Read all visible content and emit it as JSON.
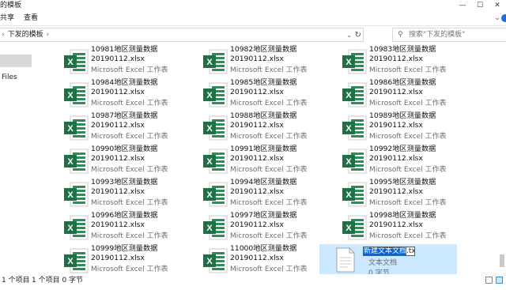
{
  "window": {
    "title": "的模板"
  },
  "window_controls": {
    "minimize": "—",
    "maximize": "☐",
    "close": "✕"
  },
  "ribbon": {
    "tabs": [
      "共享",
      "查看"
    ]
  },
  "address": {
    "path_segment": "下发的模板",
    "separator": "›"
  },
  "search": {
    "placeholder": "搜索\"下发的模板\""
  },
  "nav": {
    "files_label": "Files"
  },
  "files": [
    {
      "name1": "10981地区测量数据",
      "name2": "20190112.xlsx",
      "type": "Microsoft Excel 工作表"
    },
    {
      "name1": "10982地区测量数据",
      "name2": "20190112.xlsx",
      "type": "Microsoft Excel 工作表"
    },
    {
      "name1": "10983地区测量数据",
      "name2": "20190112.xlsx",
      "type": "Microsoft Excel 工作表"
    },
    {
      "name1": "10984地区测量数据",
      "name2": "20190112.xlsx",
      "type": "Microsoft Excel 工作表"
    },
    {
      "name1": "10985地区测量数据",
      "name2": "20190112.xlsx",
      "type": "Microsoft Excel 工作表"
    },
    {
      "name1": "10986地区测量数据",
      "name2": "20190112.xlsx",
      "type": "Microsoft Excel 工作表"
    },
    {
      "name1": "10987地区测量数据",
      "name2": "20190112.xlsx",
      "type": "Microsoft Excel 工作表"
    },
    {
      "name1": "10988地区测量数据",
      "name2": "20190112.xlsx",
      "type": "Microsoft Excel 工作表"
    },
    {
      "name1": "10989地区测量数据",
      "name2": "20190112.xlsx",
      "type": "Microsoft Excel 工作表"
    },
    {
      "name1": "10990地区测量数据",
      "name2": "20190112.xlsx",
      "type": "Microsoft Excel 工作表"
    },
    {
      "name1": "10991地区测量数据",
      "name2": "20190112.xlsx",
      "type": "Microsoft Excel 工作表"
    },
    {
      "name1": "10992地区测量数据",
      "name2": "20190112.xlsx",
      "type": "Microsoft Excel 工作表"
    },
    {
      "name1": "10993地区测量数据",
      "name2": "20190112.xlsx",
      "type": "Microsoft Excel 工作表"
    },
    {
      "name1": "10994地区测量数据",
      "name2": "20190112.xlsx",
      "type": "Microsoft Excel 工作表"
    },
    {
      "name1": "10995地区测量数据",
      "name2": "20190112.xlsx",
      "type": "Microsoft Excel 工作表"
    },
    {
      "name1": "10996地区测量数据",
      "name2": "20190112.xlsx",
      "type": "Microsoft Excel 工作表"
    },
    {
      "name1": "10997地区测量数据",
      "name2": "20190112.xlsx",
      "type": "Microsoft Excel 工作表"
    },
    {
      "name1": "10998地区测量数据",
      "name2": "20190112.xlsx",
      "type": "Microsoft Excel 工作表"
    },
    {
      "name1": "10999地区测量数据",
      "name2": "20190112.xlsx",
      "type": "Microsoft Excel 工作表"
    },
    {
      "name1": "11000地区测量数据",
      "name2": "20190112.xlsx",
      "type": "Microsoft Excel 工作表"
    }
  ],
  "new_file": {
    "rename_selected": "新建文本文档",
    "rename_ext": ".txt",
    "type": "文本文档",
    "size": "0 字节"
  },
  "status": {
    "items": "1 个项目",
    "selected": "1 个项目 0 字节"
  },
  "cursor": "↖"
}
